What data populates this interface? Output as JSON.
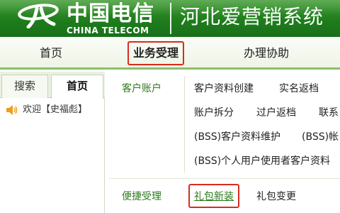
{
  "header": {
    "logo_cn": "中国电信",
    "logo_en": "CHINA TELECOM",
    "system_title": "河北爱营销系统",
    "logo_icon": "china-telecom-logo",
    "bg_color": "#1f7d1c"
  },
  "topnav": {
    "items": [
      {
        "label": "首页"
      },
      {
        "label": "业务受理"
      },
      {
        "label": "办理协助"
      }
    ],
    "highlight_color": "#d62d20"
  },
  "left_panel": {
    "tabs": [
      {
        "label": "搜索"
      },
      {
        "label": "首页"
      }
    ],
    "welcome_text": "欢迎【史福彪】",
    "welcome_icon": "speaker-icon"
  },
  "content": {
    "categories": [
      {
        "label": "客户账户",
        "links": [
          "客户资料创建",
          "实名返档",
          "账户拆分",
          "过户返档",
          "联系",
          "(BSS)客户资料维护",
          "(BSS)帐",
          "(BSS)个人用户使用者客户资料"
        ]
      },
      {
        "label": "便捷受理",
        "links": [
          "礼包新装",
          "礼包变更"
        ]
      }
    ],
    "accent_color": "#2d7a1f"
  }
}
